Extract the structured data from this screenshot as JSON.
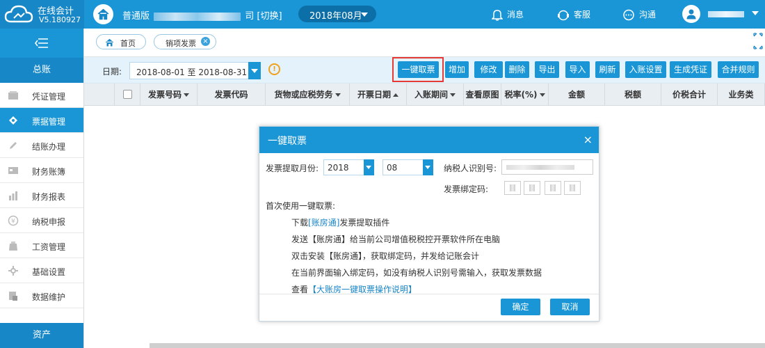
{
  "app": {
    "name": "在线会计",
    "version": "V5.180927"
  },
  "header": {
    "company_prefix": "普通版",
    "company_suffix": "司 [切换]",
    "period": "2018年08月",
    "nav": [
      {
        "label": "消息",
        "icon": "bell-icon"
      },
      {
        "label": "客服",
        "icon": "headset-icon"
      },
      {
        "label": "沟通",
        "icon": "chat-icon"
      }
    ]
  },
  "sidebar": {
    "section_top": "总账",
    "section_bottom": "资产",
    "items": [
      {
        "label": "凭证管理",
        "icon": "voucher-icon",
        "active": false
      },
      {
        "label": "票据管理",
        "icon": "invoice-icon",
        "active": true
      },
      {
        "label": "结账办理",
        "icon": "pencil-icon",
        "active": false
      },
      {
        "label": "财务账簿",
        "icon": "ledger-icon",
        "active": false
      },
      {
        "label": "财务报表",
        "icon": "bar-chart-icon",
        "active": false
      },
      {
        "label": "纳税申报",
        "icon": "tax-icon",
        "active": false
      },
      {
        "label": "工资管理",
        "icon": "wallet-icon",
        "active": false
      },
      {
        "label": "基础设置",
        "icon": "settings-icon",
        "active": false
      },
      {
        "label": "数据维护",
        "icon": "database-icon",
        "active": false
      }
    ]
  },
  "tabs": {
    "home": "首页",
    "current": "销项发票"
  },
  "toolbar": {
    "date_label": "日期:",
    "date_range": "2018-08-01 至 2018-08-31",
    "warning_glyph": "!",
    "buttons": [
      "一键取票",
      "增加",
      "修改",
      "删除",
      "导出",
      "导入",
      "刷新",
      "入账设置",
      "生成凭证",
      "合并规则"
    ]
  },
  "grid": {
    "columns": [
      {
        "label": "发票号码",
        "sort": "down"
      },
      {
        "label": "发票代码",
        "sort": ""
      },
      {
        "label": "货物或应税劳务",
        "sort": "down"
      },
      {
        "label": "开票日期",
        "sort": "up"
      },
      {
        "label": "入账期间",
        "sort": "down"
      },
      {
        "label": "查看原图",
        "sort": ""
      },
      {
        "label": "税率(%)",
        "sort": "down"
      },
      {
        "label": "金额",
        "sort": ""
      },
      {
        "label": "税额",
        "sort": ""
      },
      {
        "label": "价税合计",
        "sort": ""
      },
      {
        "label": "业务类",
        "sort": ""
      }
    ]
  },
  "dialog": {
    "title": "一键取票",
    "close_glyph": "×",
    "month_label": "发票提取月份:",
    "year_value": "2018",
    "month_value": "08",
    "taxid_label": "纳税人识别号:",
    "bindcode_label": "发票绑定码:",
    "first_use": "首次使用一键取票:",
    "step1_pre": "下载",
    "step1_link": "[账房通]",
    "step1_post": "发票提取插件",
    "step2": "发送【账房通】给当前公司增值税税控开票软件所在电脑",
    "step3": "双击安装【账房通】，获取绑定码，并发给记账会计",
    "step4": "在当前界面输入绑定码，如没有纳税人识别号需输入，获取发票数据",
    "step5_pre": "查看",
    "step5_link": "【大账房一键取票操作说明】",
    "confirm": "确定",
    "cancel": "取消"
  }
}
